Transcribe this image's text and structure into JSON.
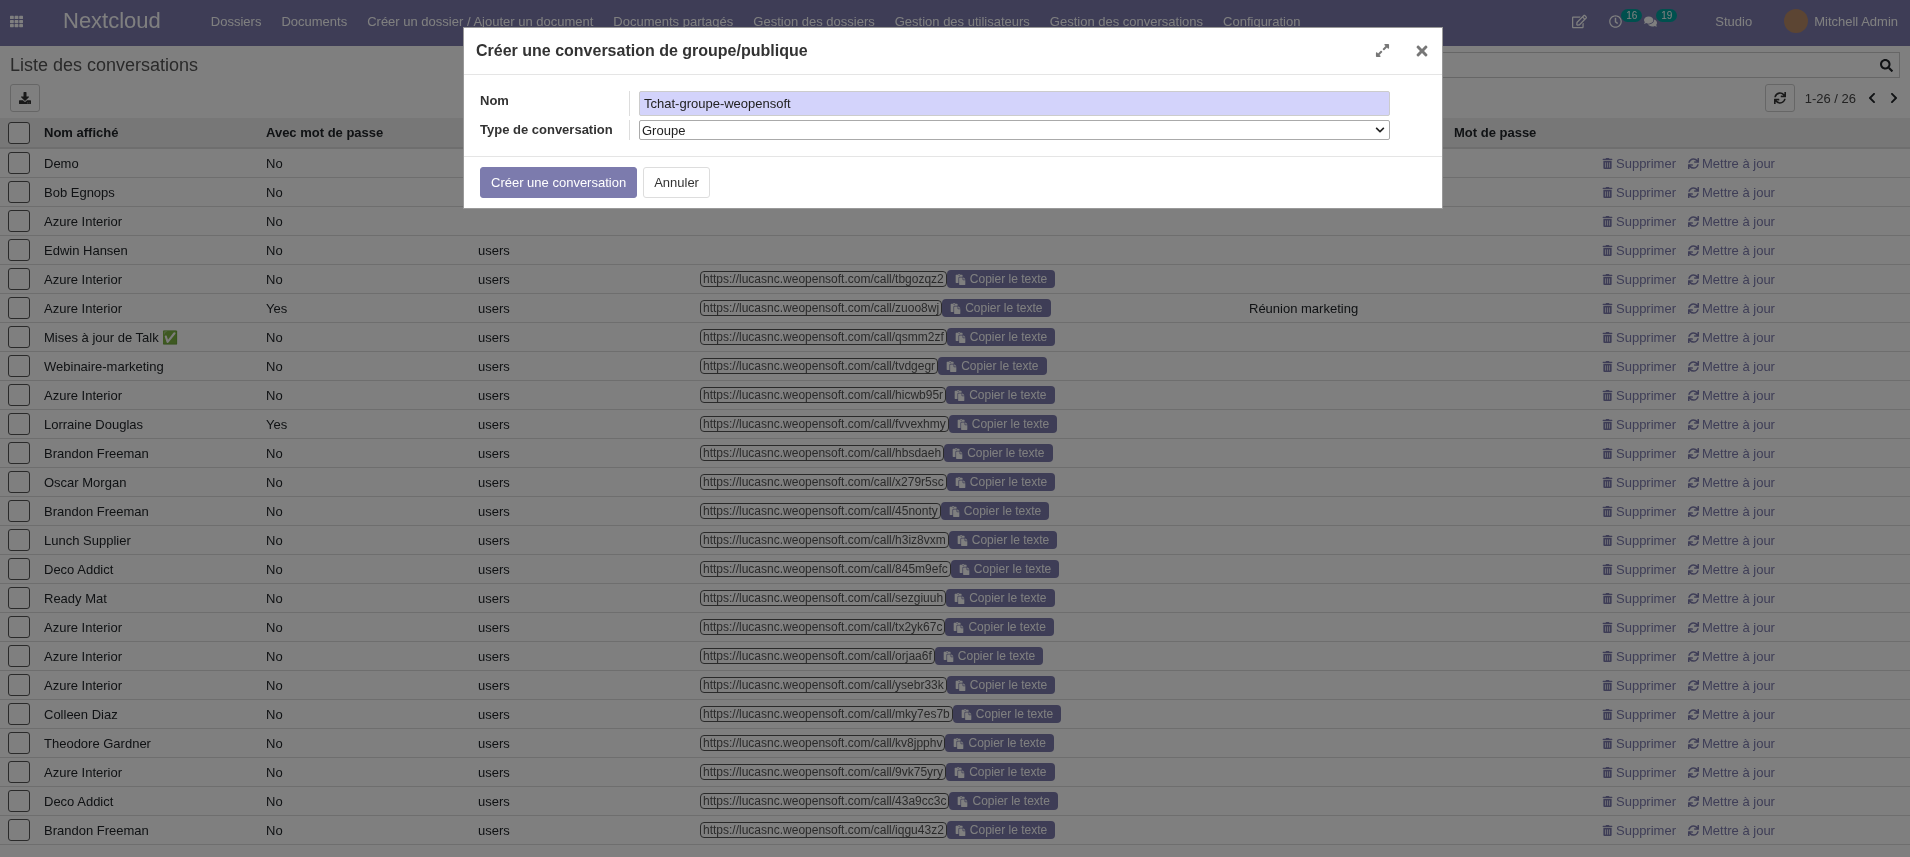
{
  "navbar": {
    "brand": "Nextcloud",
    "menu": [
      "Dossiers",
      "Documents",
      "Créer un dossier / Ajouter un document",
      "Documents partagés",
      "Gestion des dossiers",
      "Gestion des utilisateurs",
      "Gestion des conversations",
      "Configuration"
    ],
    "badges": [
      {
        "kind": "activity",
        "count": "16"
      },
      {
        "kind": "chat",
        "count": "19"
      }
    ],
    "studio": "Studio",
    "user": "Mitchell Admin"
  },
  "page": {
    "title": "Liste des conversations",
    "pager": "1-26 / 26"
  },
  "table": {
    "header": {
      "checked": false,
      "name": "Nom affiché",
      "with_password": "Avec mot de passe",
      "password": "Mot de passe"
    },
    "rows": [
      {
        "checked": false,
        "name": "Demo",
        "with_password": "No",
        "delete": "Supprimer",
        "update": "Mettre à jour"
      },
      {
        "checked": false,
        "name": "Bob Egnops",
        "with_password": "No",
        "delete": "Supprimer",
        "update": "Mettre à jour"
      },
      {
        "checked": false,
        "name": "Azure Interior",
        "with_password": "No",
        "delete": "Supprimer",
        "update": "Mettre à jour"
      },
      {
        "checked": false,
        "name": "Edwin Hansen",
        "with_password": "No",
        "column_3": "users",
        "delete": "Supprimer",
        "update": "Mettre à jour"
      },
      {
        "checked": false,
        "name": "Azure Interior",
        "with_password": "No",
        "column_3": "users",
        "url": "https://lucasnc.weopensoft.com/call/tbgozqz2",
        "copy": "Copier le texte",
        "delete": "Supprimer",
        "update": "Mettre à jour"
      },
      {
        "checked": false,
        "name": "Azure Interior",
        "with_password": "Yes",
        "column_3": "users",
        "url": "https://lucasnc.weopensoft.com/call/zuoo8wj",
        "copy": "Copier le texte",
        "column_5": "Réunion marketing",
        "delete": "Supprimer",
        "update": "Mettre à jour"
      },
      {
        "checked": false,
        "name": "Mises à jour de Talk ✅",
        "with_password": "No",
        "column_3": "users",
        "url": "https://lucasnc.weopensoft.com/call/qsmm2zf",
        "copy": "Copier le texte",
        "delete": "Supprimer",
        "update": "Mettre à jour"
      },
      {
        "checked": false,
        "name": "Webinaire-marketing",
        "with_password": "No",
        "column_3": "users",
        "url": "https://lucasnc.weopensoft.com/call/tvdgegr",
        "copy": "Copier le texte",
        "delete": "Supprimer",
        "update": "Mettre à jour"
      },
      {
        "checked": false,
        "name": "Azure Interior",
        "with_password": "No",
        "column_3": "users",
        "url": "https://lucasnc.weopensoft.com/call/hicwb95r",
        "copy": "Copier le texte",
        "delete": "Supprimer",
        "update": "Mettre à jour"
      },
      {
        "checked": false,
        "name": "Lorraine Douglas",
        "with_password": "Yes",
        "column_3": "users",
        "url": "https://lucasnc.weopensoft.com/call/fvvexhmy",
        "copy": "Copier le texte",
        "delete": "Supprimer",
        "update": "Mettre à jour"
      },
      {
        "checked": false,
        "name": "Brandon Freeman",
        "with_password": "No",
        "column_3": "users",
        "url": "https://lucasnc.weopensoft.com/call/hbsdaeh",
        "copy": "Copier le texte",
        "delete": "Supprimer",
        "update": "Mettre à jour"
      },
      {
        "checked": false,
        "name": "Oscar Morgan",
        "with_password": "No",
        "column_3": "users",
        "url": "https://lucasnc.weopensoft.com/call/x279r5sc",
        "copy": "Copier le texte",
        "delete": "Supprimer",
        "update": "Mettre à jour"
      },
      {
        "checked": false,
        "name": "Brandon Freeman",
        "with_password": "No",
        "column_3": "users",
        "url": "https://lucasnc.weopensoft.com/call/45nonty",
        "copy": "Copier le texte",
        "delete": "Supprimer",
        "update": "Mettre à jour"
      },
      {
        "checked": false,
        "name": "Lunch Supplier",
        "with_password": "No",
        "column_3": "users",
        "url": "https://lucasnc.weopensoft.com/call/h3iz8vxm",
        "copy": "Copier le texte",
        "delete": "Supprimer",
        "update": "Mettre à jour"
      },
      {
        "checked": false,
        "name": "Deco Addict",
        "with_password": "No",
        "column_3": "users",
        "url": "https://lucasnc.weopensoft.com/call/845m9efc",
        "copy": "Copier le texte",
        "delete": "Supprimer",
        "update": "Mettre à jour"
      },
      {
        "checked": false,
        "name": "Ready Mat",
        "with_password": "No",
        "column_3": "users",
        "url": "https://lucasnc.weopensoft.com/call/sezgiuuh",
        "copy": "Copier le texte",
        "delete": "Supprimer",
        "update": "Mettre à jour"
      },
      {
        "checked": false,
        "name": "Azure Interior",
        "with_password": "No",
        "column_3": "users",
        "url": "https://lucasnc.weopensoft.com/call/tx2yk67c",
        "copy": "Copier le texte",
        "delete": "Supprimer",
        "update": "Mettre à jour"
      },
      {
        "checked": false,
        "name": "Azure Interior",
        "with_password": "No",
        "column_3": "users",
        "url": "https://lucasnc.weopensoft.com/call/orjaa6f",
        "copy": "Copier le texte",
        "delete": "Supprimer",
        "update": "Mettre à jour"
      },
      {
        "checked": false,
        "name": "Azure Interior",
        "with_password": "No",
        "column_3": "users",
        "url": "https://lucasnc.weopensoft.com/call/ysebr33k",
        "copy": "Copier le texte",
        "delete": "Supprimer",
        "update": "Mettre à jour"
      },
      {
        "checked": false,
        "name": "Colleen Diaz",
        "with_password": "No",
        "column_3": "users",
        "url": "https://lucasnc.weopensoft.com/call/mky7es7b",
        "copy": "Copier le texte",
        "delete": "Supprimer",
        "update": "Mettre à jour"
      },
      {
        "checked": false,
        "name": "Theodore Gardner",
        "with_password": "No",
        "column_3": "users",
        "url": "https://lucasnc.weopensoft.com/call/kv8jpphv",
        "copy": "Copier le texte",
        "delete": "Supprimer",
        "update": "Mettre à jour"
      },
      {
        "checked": false,
        "name": "Azure Interior",
        "with_password": "No",
        "column_3": "users",
        "url": "https://lucasnc.weopensoft.com/call/9vk75yry",
        "copy": "Copier le texte",
        "delete": "Supprimer",
        "update": "Mettre à jour"
      },
      {
        "checked": false,
        "name": "Deco Addict",
        "with_password": "No",
        "column_3": "users",
        "url": "https://lucasnc.weopensoft.com/call/43a9cc3c",
        "copy": "Copier le texte",
        "delete": "Supprimer",
        "update": "Mettre à jour"
      },
      {
        "checked": false,
        "name": "Brandon Freeman",
        "with_password": "No",
        "column_3": "users",
        "url": "https://lucasnc.weopensoft.com/call/iqgu43z2",
        "copy": "Copier le texte",
        "delete": "Supprimer",
        "update": "Mettre à jour"
      }
    ]
  },
  "modal": {
    "title": "Créer une conversation de groupe/publique",
    "fields": [
      {
        "kind": "text",
        "label": "Nom",
        "value": "Tchat-groupe-weopensoft"
      },
      {
        "kind": "select",
        "label": "Type de conversation",
        "value": "Groupe"
      }
    ],
    "buttons": [
      {
        "kind": "primary",
        "label": "Créer une conversation"
      },
      {
        "kind": "secondary",
        "label": "Annuler"
      }
    ]
  }
}
